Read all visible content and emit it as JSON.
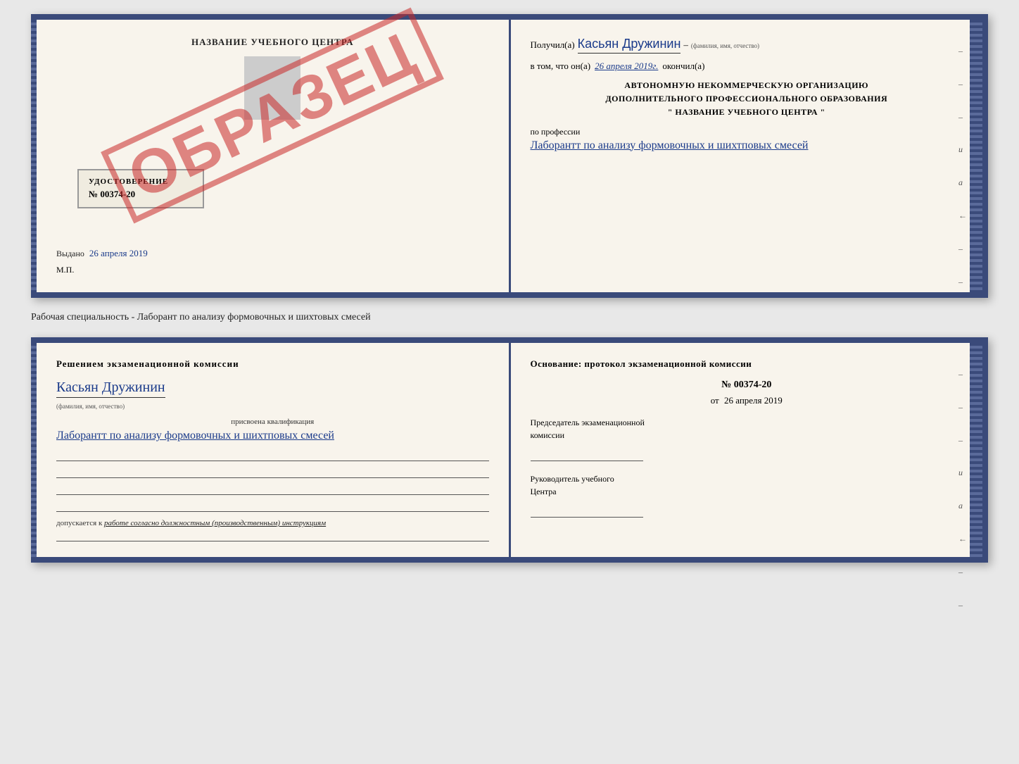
{
  "top_cert": {
    "left": {
      "title": "НАЗВАНИЕ УЧЕБНОГО ЦЕНТРА",
      "stamp_text": "ОБРАЗЕЦ",
      "udostoverenie": {
        "label": "УДОСТОВЕРЕНИЕ",
        "number": "№ 00374-20"
      },
      "vydano": "Выдано",
      "vydano_date": "26 апреля 2019",
      "mp": "М.П."
    },
    "right": {
      "poluchil_label": "Получил(а)",
      "poluchil_name": "Касьян Дружинин",
      "fio_label": "(фамилия, имя, отчество)",
      "dash": "–",
      "vtom_label": "в том, что он(а)",
      "vtom_date": "26 апреля 2019г.",
      "okonchil": "окончил(а)",
      "org_line1": "АВТОНОМНУЮ НЕКОММЕРЧЕСКУЮ ОРГАНИЗАЦИЮ",
      "org_line2": "ДОПОЛНИТЕЛЬНОГО ПРОФЕССИОНАЛЬНОГО ОБРАЗОВАНИЯ",
      "org_line3": "\" НАЗВАНИЕ УЧЕБНОГО ЦЕНТРА \"",
      "po_professii": "по профессии",
      "profession_handwritten": "Лаборантт по анализу формовочных и шихтповых смесей",
      "dashes": [
        "–",
        "–",
        "–",
        "и",
        "а",
        "←",
        "–",
        "–"
      ]
    }
  },
  "subtitle": "Рабочая специальность - Лаборант по анализу формовочных и шихтовых смесей",
  "bottom_cert": {
    "left": {
      "title": "Решением экзаменационной комиссии",
      "kasyan_name": "Касьян Дружинин",
      "fio_label": "(фамилия, имя, отчество)",
      "prisvoena": "присвоена квалификация",
      "qualification": "Лаборантт по анализу формовочных и шихтповых смесей",
      "dopuskaetsya_label": "допускается к",
      "dopuskaetsya_text": "работе согласно должностным (производственным) инструкциям"
    },
    "right": {
      "osnovanie": "Основание: протокол экзаменационной комиссии",
      "protocol_number": "№ 00374-20",
      "ot_label": "от",
      "ot_date": "26 апреля 2019",
      "predsedatel_line1": "Председатель экзаменационной",
      "predsedatel_line2": "комиссии",
      "rukovoditel_line1": "Руководитель учебного",
      "rukovoditel_line2": "Центра",
      "dashes": [
        "–",
        "–",
        "–",
        "и",
        "а",
        "←",
        "–",
        "–"
      ]
    }
  }
}
